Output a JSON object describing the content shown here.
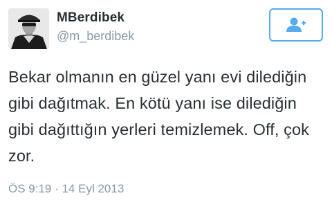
{
  "user": {
    "display_name": "MBerdibek",
    "handle": "@m_berdibek",
    "avatar_icon": "profile-photo"
  },
  "follow_button": {
    "icon": "add-user-icon",
    "accent_color": "#55acee"
  },
  "tweet": {
    "text": "Bekar olmanın en güzel yanı evi dilediğin gibi dağıtmak. En kötü yanı ise dilediğin gibi dağıttığın yerleri temizlemek. Off, çok zor.",
    "timestamp": "ÖS 9:19 · 14 Eyl 2013"
  },
  "colors": {
    "text": "#292f33",
    "muted": "#8899a6",
    "accent": "#55acee"
  }
}
